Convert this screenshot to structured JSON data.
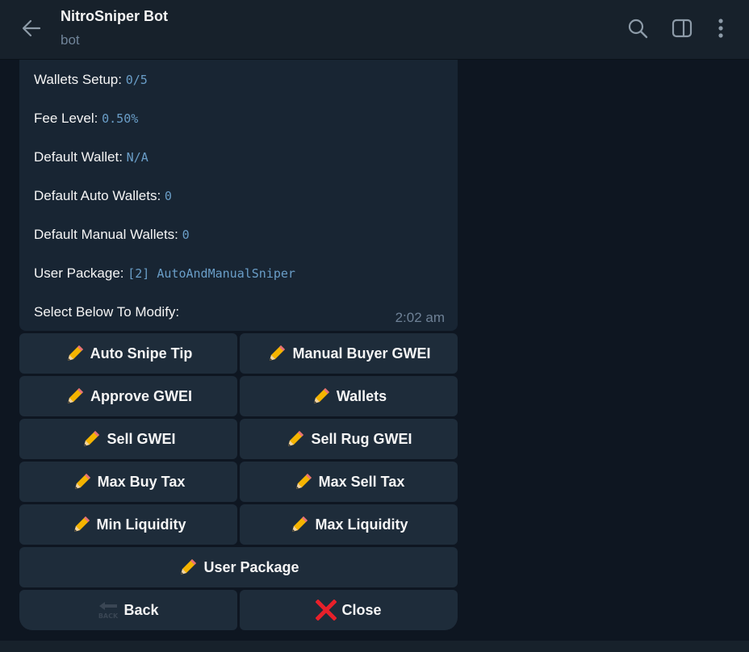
{
  "header": {
    "title": "NitroSniper Bot",
    "subtitle": "bot",
    "icons": [
      "back-arrow-icon",
      "search-icon",
      "sidebar-toggle-icon",
      "more-vertical-icon"
    ]
  },
  "message": {
    "lines": [
      {
        "label": "Wallets Setup:",
        "value": "0/5"
      },
      {
        "label": "Fee Level:",
        "value": "0.50%"
      },
      {
        "label": "Default Wallet:",
        "value": "N/A"
      },
      {
        "label": "Default Auto Wallets:",
        "value": "0"
      },
      {
        "label": "Default Manual Wallets:",
        "value": "0"
      },
      {
        "label": "User Package:",
        "value": "[2] AutoAndManualSniper"
      },
      {
        "label": "Select Below To Modify:",
        "value": ""
      }
    ],
    "time": "2:02 am"
  },
  "keyboard": {
    "auto_snipe_tip": "Auto Snipe Tip",
    "manual_buyer_gwei": "Manual Buyer GWEI",
    "approve_gwei": "Approve GWEI",
    "wallets": "Wallets",
    "sell_gwei": "Sell GWEI",
    "sell_rug_gwei": "Sell Rug GWEI",
    "max_buy_tax": "Max Buy Tax",
    "max_sell_tax": "Max Sell Tax",
    "min_liquidity": "Min Liquidity",
    "max_liquidity": "Max Liquidity",
    "user_package": "User Package",
    "back": "Back",
    "back_icon_text": "BACK",
    "close": "Close"
  },
  "colors": {
    "background": "#0e1621",
    "header": "#17212b",
    "bubble": "#182533",
    "button": "#1e2c3a",
    "value_text": "#6a9ec8",
    "close_x": "#e8202a"
  }
}
